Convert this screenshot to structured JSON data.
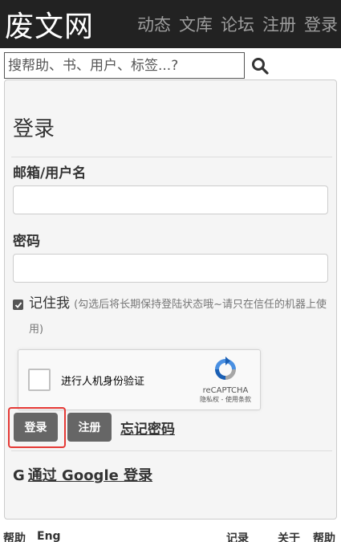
{
  "header": {
    "logo": "废文网",
    "nav": [
      "动态",
      "文库",
      "论坛",
      "注册",
      "登录"
    ]
  },
  "search": {
    "placeholder": "搜帮助、书、用户、标签...?"
  },
  "login": {
    "title": "登录",
    "email_label": "邮箱/用户名",
    "password_label": "密码",
    "remember_label": "记住我",
    "remember_hint": "(勾选后将长期保持登陆状态哦~请只在信任的机器上使用)",
    "captcha_text": "进行人机身份验证",
    "captcha_brand": "reCAPTCHA",
    "captcha_terms": "隐私权 - 使用条款",
    "login_button": "登录",
    "register_button": "注册",
    "forgot_link": "忘记密码",
    "google_prefix": "G",
    "google_link": "通过 Google 登录"
  },
  "footer": {
    "left1": "帮助",
    "left2": "Eng",
    "right1": "记录",
    "right2": "关于",
    "right3": "帮助"
  }
}
